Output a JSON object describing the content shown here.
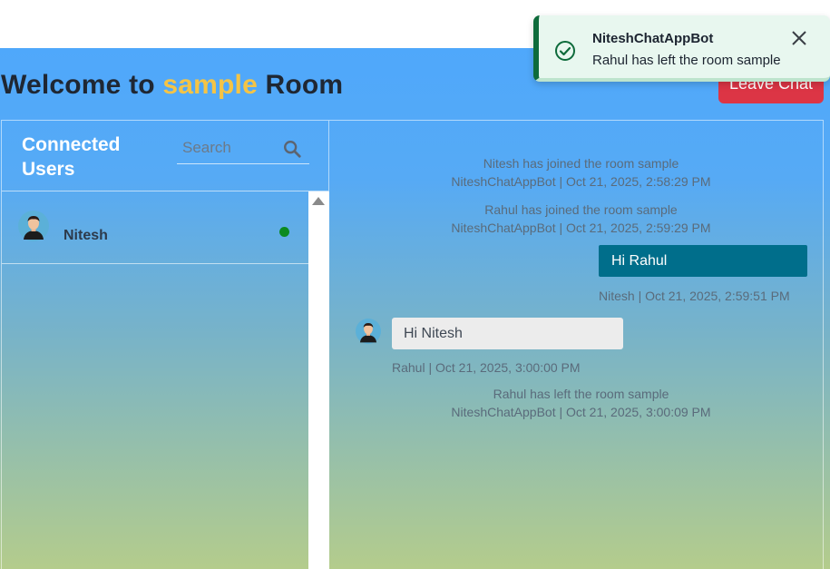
{
  "header": {
    "prefix": "Welcome to ",
    "room_name": "sample",
    "suffix": " Room",
    "room_name_color": "#f5c445"
  },
  "leave_button": {
    "label": "Leave Chat",
    "color": "#dc3545"
  },
  "users_panel": {
    "heading": "Connected Users",
    "search": {
      "placeholder": "Search",
      "value": "",
      "icon": "search-icon"
    },
    "users": [
      {
        "name": "Nitesh",
        "status": "online",
        "status_color": "#0b8a20",
        "avatar": "user-avatar-icon"
      }
    ]
  },
  "chat": {
    "system_messages": [
      {
        "text": "Nitesh has joined the room sample",
        "meta": "NiteshChatAppBot | Oct 21, 2025, 2:58:29 PM"
      },
      {
        "text": "Rahul has joined the room sample",
        "meta": "NiteshChatAppBot | Oct 21, 2025, 2:59:29 PM"
      },
      {
        "text": "Rahul has left the room sample",
        "meta": "NiteshChatAppBot | Oct 21, 2025, 3:00:09 PM"
      }
    ],
    "outgoing": {
      "text": "Hi Rahul",
      "meta": "Nitesh | Oct 21, 2025, 2:59:51 PM",
      "color": "#006e8b"
    },
    "incoming": {
      "text": "Hi Nitesh",
      "meta": "Rahul | Oct 21, 2025, 3:00:00 PM",
      "color": "#ececec"
    }
  },
  "toast": {
    "title": "NiteshChatAppBot",
    "message": "Rahul has left the room sample",
    "icon": "check-circle-icon",
    "accent_color": "#0e6b3b"
  }
}
